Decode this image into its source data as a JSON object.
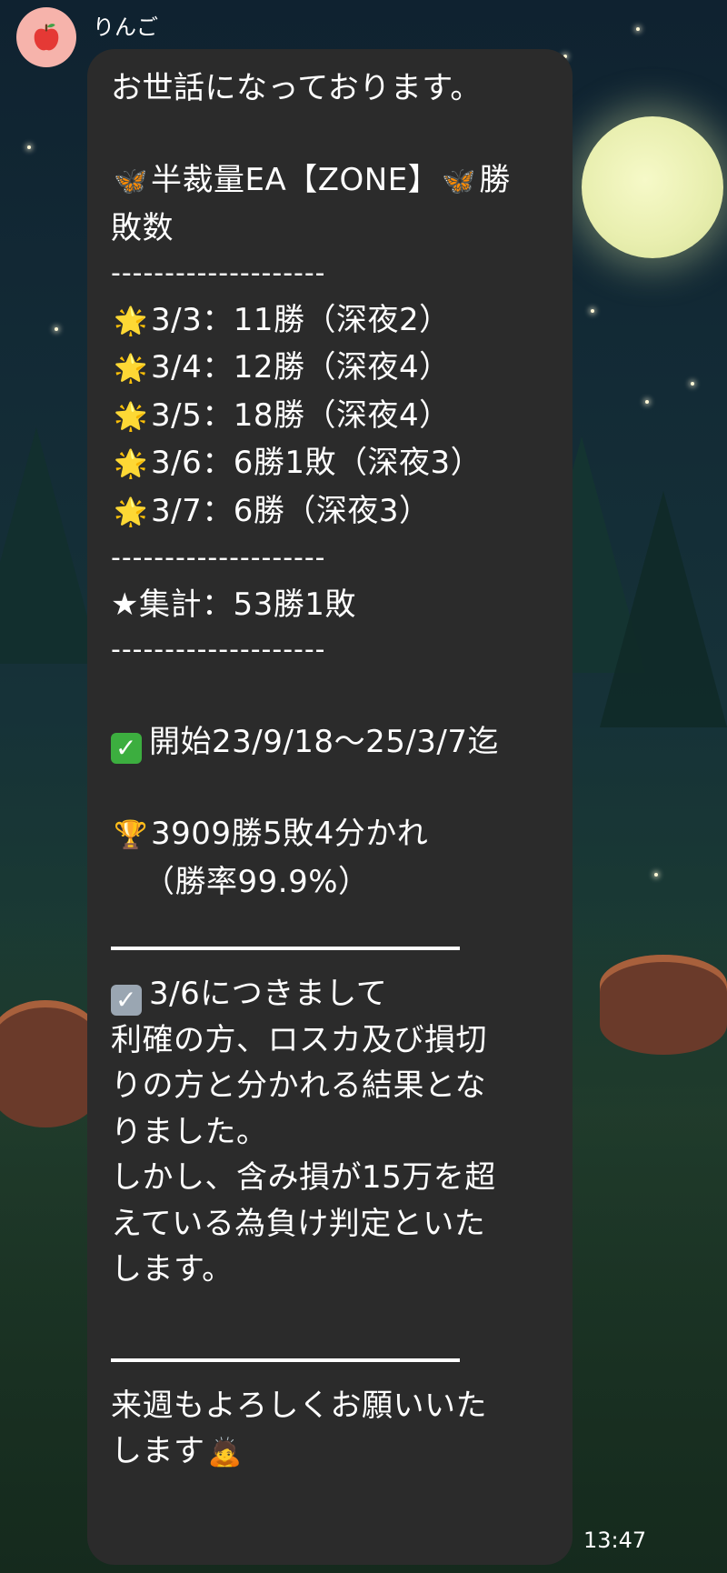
{
  "header": {
    "sender_name": "りんご"
  },
  "message": {
    "greeting": "お世話になっております。",
    "title_line1": "半裁量EA【ZONE】",
    "title_line1_tail": "勝",
    "title_line2": "敗数",
    "divider": "--------------------",
    "results": [
      "3/3：11勝（深夜2）",
      "3/4：12勝（深夜4）",
      "3/5：18勝（深夜4）",
      "3/6：6勝1敗（深夜3）",
      "3/7：6勝（深夜3）"
    ],
    "total": "★集計：53勝1敗",
    "period": "開始23/9/18〜25/3/7迄",
    "record_line1": "3909勝5敗4分かれ",
    "record_line2": "（勝率99.9%）",
    "note_heading": "3/6につきまして",
    "note_lines": [
      "利確の方、ロスカ及び損切",
      "りの方と分かれる結果とな",
      "りました。",
      "しかし、含み損が15万を超",
      "えている為負け判定といた",
      "します。"
    ],
    "closing_line1": "来週もよろしくお願いいた",
    "closing_line2": "します"
  },
  "timestamp": "13:47",
  "icons": {
    "avatar": "apple-icon",
    "title": "butterfly-icon",
    "results": "glowing-star-icon",
    "period": "check-mark-button-icon",
    "record": "trophy-icon",
    "note": "check-box-icon",
    "closing": "person-bowing-icon"
  },
  "colors": {
    "bubble": "#2b2b2b",
    "avatar_bg": "#f6b3ab",
    "text": "#ffffff"
  }
}
